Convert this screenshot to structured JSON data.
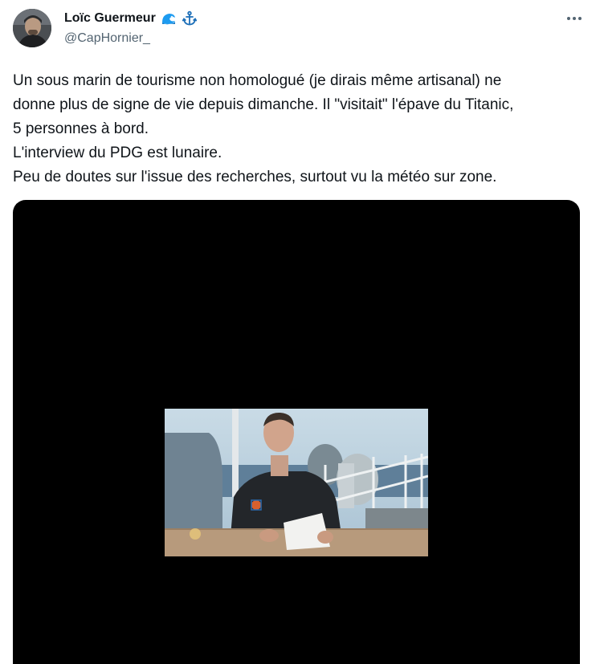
{
  "author": {
    "display_name": "Loïc Guermeur",
    "handle": "@CapHornier_",
    "name_emojis": [
      "wave-emoji",
      "anchor-emoji"
    ]
  },
  "menu": {
    "icon": "more-horizontal-icon"
  },
  "tweet": {
    "lines": [
      "Un sous marin de tourisme non homologué (je dirais même artisanal) ne",
      "donne plus de signe de vie depuis dimanche. Il \"visitait\" l'épave du Titanic,",
      "5 personnes à bord.",
      "L'interview du PDG est lunaire.",
      "Peu de doutes sur l'issue des recherches, surtout vu la météo sur zone."
    ]
  },
  "media": {
    "type": "video",
    "background": "#000000"
  },
  "colors": {
    "text": "#0f1419",
    "secondary": "#536471",
    "wave": "#1d9bf0",
    "anchor": "#1d6fb8"
  }
}
